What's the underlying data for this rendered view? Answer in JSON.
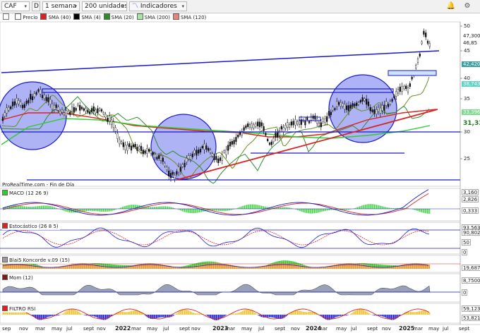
{
  "toolbar": {
    "ticker": "CAF",
    "mode": "D",
    "timeframe": "1 semana",
    "units": "200 unidades",
    "indicators": "Indicadores"
  },
  "legend": [
    {
      "label": "Precio",
      "color": "#ffffff"
    },
    {
      "label": "SMA (40)",
      "color": "#e02020"
    },
    {
      "label": "SMA (4)",
      "color": "#000000"
    },
    {
      "label": "SMA (20)",
      "color": "#2e8b2e"
    },
    {
      "label": "SMA (200)",
      "color": "#a8e6a8"
    },
    {
      "label": "SMA (120)",
      "color": "#f08080"
    }
  ],
  "main": {
    "source_note": "ProRealTime.com - Fin de Día",
    "y_ticks": [
      "50",
      "45",
      "40",
      "35",
      "30",
      "25"
    ],
    "labels": [
      {
        "text": "47,300",
        "bg": "#ffffff",
        "fg": "#222222"
      },
      {
        "text": "46,85",
        "bg": "#ffffff",
        "fg": "#222222"
      },
      {
        "text": "42,420",
        "bg": "#3a9f9f",
        "fg": "#ffffff"
      },
      {
        "text": "38,743",
        "bg": "#5fd3c4",
        "fg": "#ffffff"
      },
      {
        "text": "33,396",
        "bg": "#7fd98f",
        "fg": "#ffffff"
      },
      {
        "text": "31,33",
        "bg": "#ffffff",
        "fg": "#1a7a1a"
      }
    ]
  },
  "panels": {
    "macd": {
      "title": "MACD (12 26 9)",
      "values": [
        "3,160",
        "2,826",
        "0,333"
      ]
    },
    "stoch": {
      "title": "Estocástico (26 8 5)",
      "values": [
        "93,563",
        "90,802",
        "50",
        "0"
      ]
    },
    "blai5": {
      "title": "Blai5 Koncorde v.09 (15)",
      "values": [
        "",
        "19,687"
      ]
    },
    "mom": {
      "title": "Mom (12)",
      "values": [
        "8,7500",
        "0"
      ]
    },
    "filtro": {
      "title": "FILTRO RSI",
      "values": [
        "59,123",
        "53,821"
      ]
    }
  },
  "x_axis": [
    {
      "text": "sep",
      "bold": false
    },
    {
      "text": "nov",
      "bold": false
    },
    {
      "text": "mar",
      "bold": false
    },
    {
      "text": "may",
      "bold": false
    },
    {
      "text": "jul",
      "bold": false
    },
    {
      "text": "sept",
      "bold": false
    },
    {
      "text": "nov",
      "bold": false
    },
    {
      "text": "2022",
      "bold": true
    },
    {
      "text": "mar",
      "bold": false
    },
    {
      "text": "may",
      "bold": false
    },
    {
      "text": "jul",
      "bold": false
    },
    {
      "text": "sept",
      "bold": false
    },
    {
      "text": "nov",
      "bold": false
    },
    {
      "text": "2023",
      "bold": true
    },
    {
      "text": "mar",
      "bold": false
    },
    {
      "text": "may",
      "bold": false
    },
    {
      "text": "jul",
      "bold": false
    },
    {
      "text": "sept",
      "bold": false
    },
    {
      "text": "nov",
      "bold": false
    },
    {
      "text": "2024",
      "bold": true
    },
    {
      "text": "mar",
      "bold": false
    },
    {
      "text": "may",
      "bold": false
    },
    {
      "text": "jul",
      "bold": false
    },
    {
      "text": "sept",
      "bold": false
    },
    {
      "text": "nov",
      "bold": false
    },
    {
      "text": "2025",
      "bold": true
    },
    {
      "text": "mar",
      "bold": false
    },
    {
      "text": "may",
      "bold": false
    },
    {
      "text": "jul",
      "bold": false
    },
    {
      "text": "sept",
      "bold": false
    }
  ],
  "colors": {
    "circle_fill": "#7c84f0",
    "trendline": "#1a1acc",
    "support": "#e02020",
    "sma40": "#e02020",
    "sma20": "#2e8b2e",
    "sma200": "#2ecc2e",
    "macd_hist": "#2ecc2e"
  }
}
